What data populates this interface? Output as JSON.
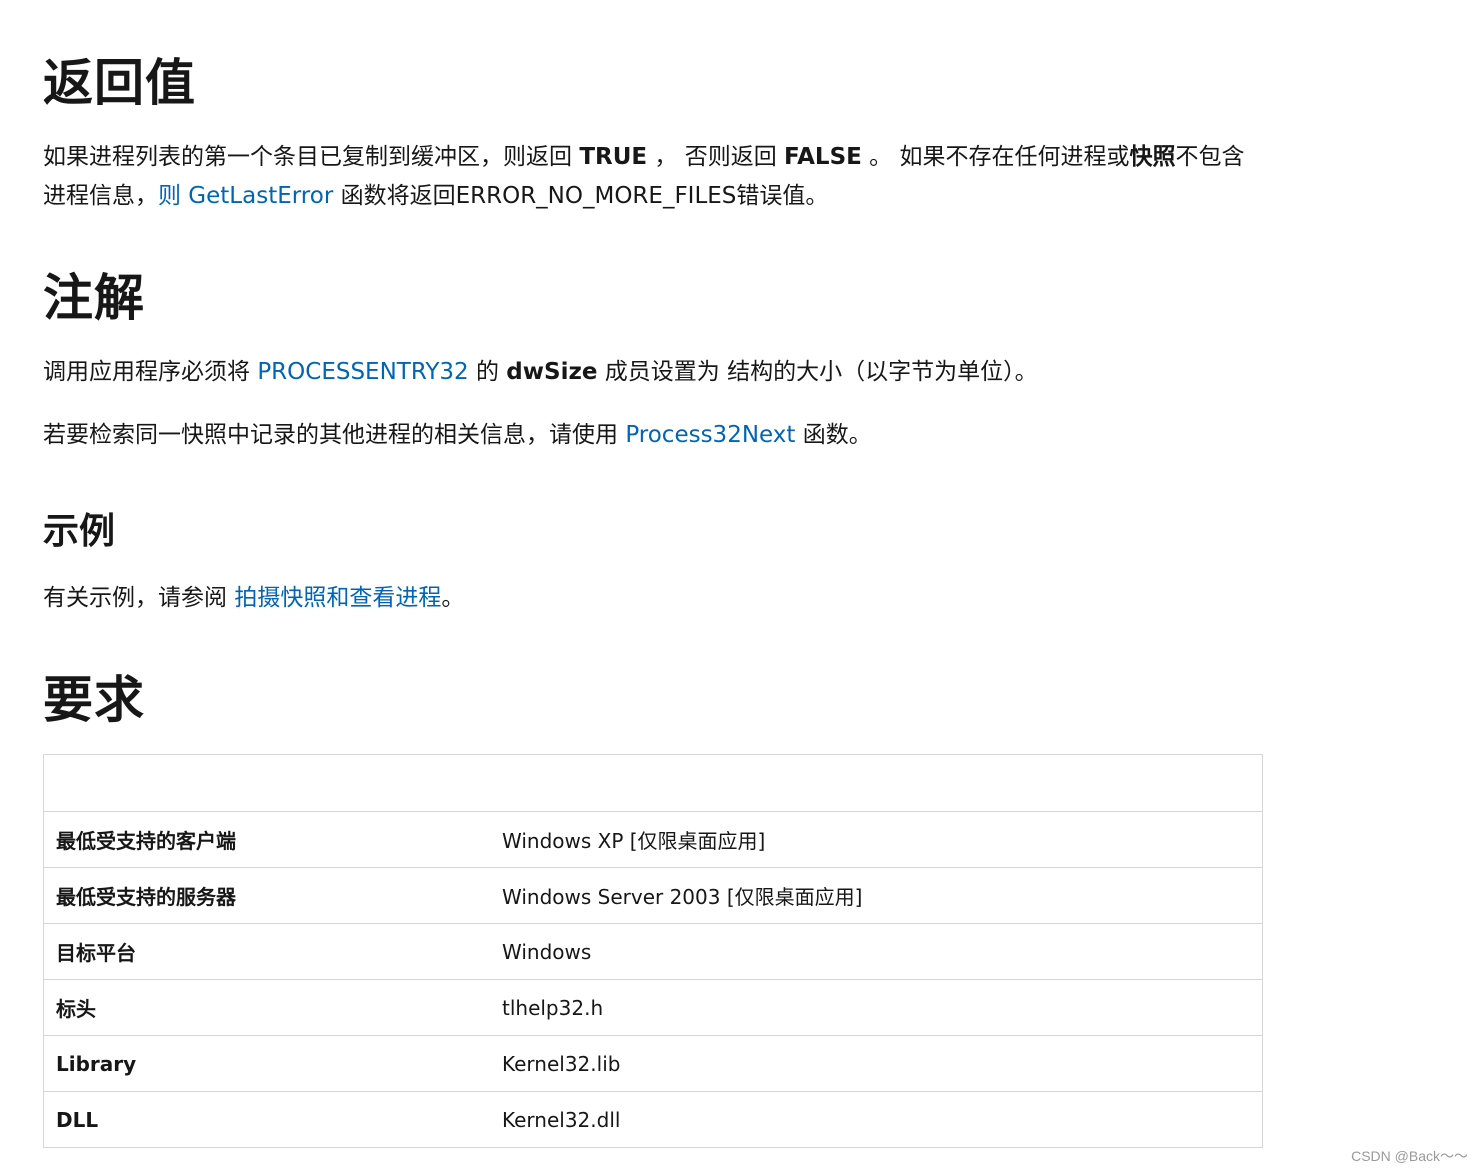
{
  "sections": {
    "return_value": {
      "heading": "返回值",
      "line1_a": "如果进程列表的第一个条目已复制到缓冲区，则返回 ",
      "line1_true": "TRUE",
      "line1_b": " ， 否则返回 ",
      "line1_false": "FALSE",
      "line1_c": " 。 如果不存在任何进程或",
      "line1_snapshot": "快照",
      "line1_d": "不包含",
      "line2_a": "进程信息，",
      "line2_link": "则 GetLastError",
      "line2_b": " 函数将返回ERROR_NO_MORE_FILES错误值。"
    },
    "remarks": {
      "heading": "注解",
      "p1_a": "调用应用程序必须将 ",
      "p1_link": "PROCESSENTRY32",
      "p1_b": " 的 ",
      "p1_bold": "dwSize",
      "p1_c": " 成员设置为 结构的大小（以字节为单位）。",
      "p2_a": "若要检索同一快照中记录的其他进程的相关信息，请使用 ",
      "p2_link": "Process32Next",
      "p2_b": " 函数。"
    },
    "examples": {
      "heading": "示例",
      "p_a": "有关示例，请参阅 ",
      "p_link": "拍摄快照和查看进程",
      "p_b": "。"
    },
    "requirements": {
      "heading": "要求",
      "rows": [
        {
          "key": "最低受支持的客户端",
          "value": "Windows XP [仅限桌面应用]"
        },
        {
          "key": "最低受支持的服务器",
          "value": "Windows Server 2003 [仅限桌面应用]"
        },
        {
          "key": "目标平台",
          "value": "Windows"
        },
        {
          "key": "标头",
          "value": "tlhelp32.h"
        },
        {
          "key": "Library",
          "value": "Kernel32.lib"
        },
        {
          "key": "DLL",
          "value": "Kernel32.dll"
        }
      ]
    }
  },
  "watermark": "CSDN @Back～～",
  "colors": {
    "link": "#0065b3",
    "text": "#171717",
    "border": "#d6d6d6"
  }
}
